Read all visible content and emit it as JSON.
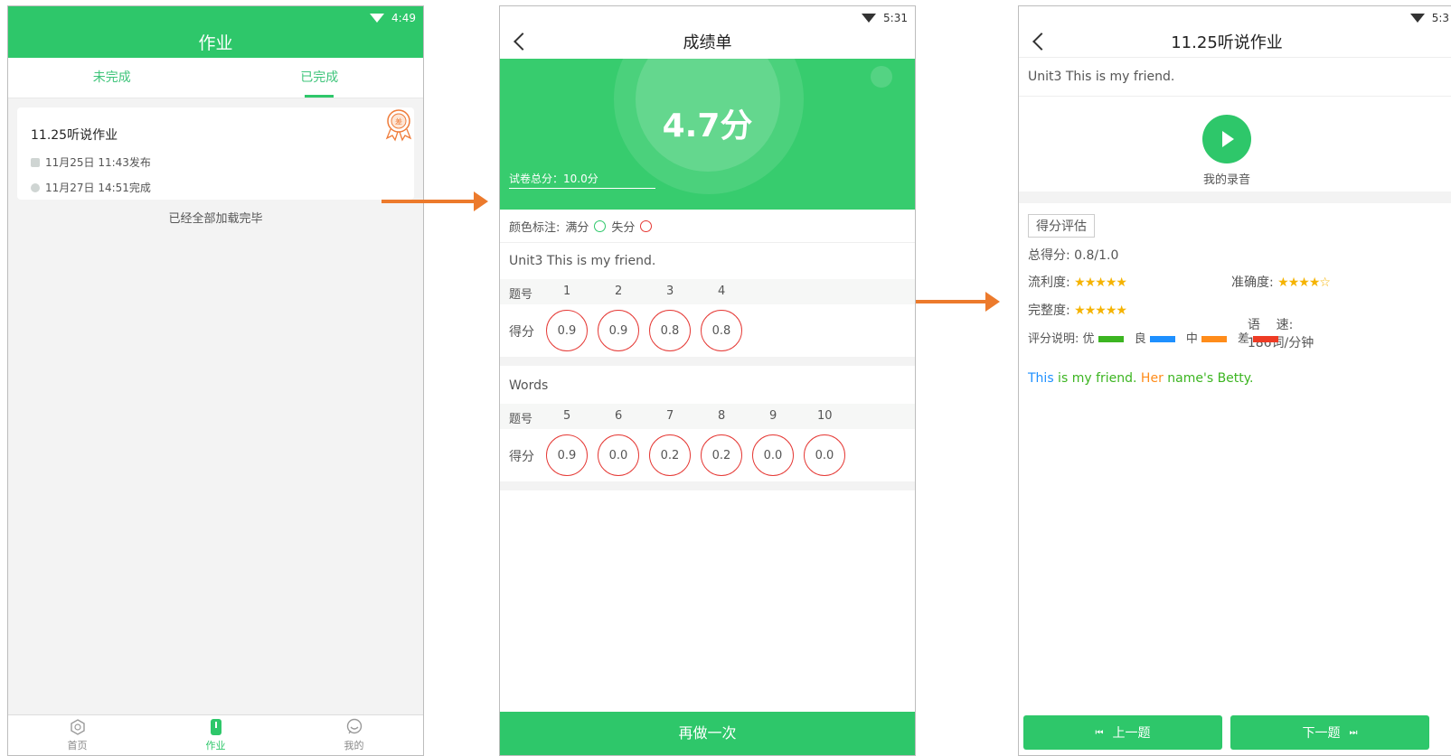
{
  "screen1": {
    "status_time": "4:49",
    "title": "作业",
    "tabs": [
      {
        "label": "未完成"
      },
      {
        "label": "已完成"
      }
    ],
    "card": {
      "title": "11.25听说作业",
      "published": "11月25日 11:43发布",
      "completed": "11月27日 14:51完成",
      "badge": "差"
    },
    "loaded_text": "已经全部加载完毕",
    "nav": [
      {
        "label": "首页"
      },
      {
        "label": "作业"
      },
      {
        "label": "我的"
      }
    ]
  },
  "screen2": {
    "status_time": "5:31",
    "title": "成绩单",
    "score": "4.7分",
    "total": "试卷总分：10.0分",
    "legend": {
      "label": "颜色标注:",
      "full": "满分",
      "lost": "失分"
    },
    "section1": {
      "title": "Unit3 This is my friend.",
      "num_label": "题号",
      "score_label": "得分",
      "numbers": [
        "1",
        "2",
        "3",
        "4"
      ],
      "scores": [
        "0.9",
        "0.9",
        "0.8",
        "0.8"
      ]
    },
    "section2": {
      "title": "Words",
      "num_label": "题号",
      "score_label": "得分",
      "numbers": [
        "5",
        "6",
        "7",
        "8",
        "9",
        "10"
      ],
      "scores": [
        "0.9",
        "0.0",
        "0.2",
        "0.2",
        "0.0",
        "0.0"
      ]
    },
    "redo_label": "再做一次"
  },
  "screen3": {
    "status_time": "5:3",
    "title": "11.25听说作业",
    "unit": "Unit3 This is my friend.",
    "recording_label": "我的录音",
    "eval_tag": "得分评估",
    "total_score": "总得分:  0.8/1.0",
    "fluency_label": "流利度:",
    "fluency_stars": "★★★★★",
    "accuracy_label": "准确度:",
    "accuracy_stars": "★★★★☆",
    "completeness_label": "完整度:",
    "completeness_stars": "★★★★★",
    "speed_label": "语    速:",
    "speed_value": "186词/分钟",
    "rating_label": "评分说明:",
    "rating_levels": [
      {
        "label": "优",
        "color": "#3cb521"
      },
      {
        "label": "良",
        "color": "#1e90ff"
      },
      {
        "label": "中",
        "color": "#ff8c1a"
      },
      {
        "label": "差",
        "color": "#ee3b24"
      }
    ],
    "sentence": [
      {
        "text": "This",
        "color": "#1e90ff"
      },
      {
        "text": " is my friend. ",
        "color": "#3cb521"
      },
      {
        "text": "Her",
        "color": "#ff8c1a"
      },
      {
        "text": " name's Betty.",
        "color": "#3cb521"
      }
    ],
    "prev_label": "上一题",
    "next_label": "下一题"
  }
}
